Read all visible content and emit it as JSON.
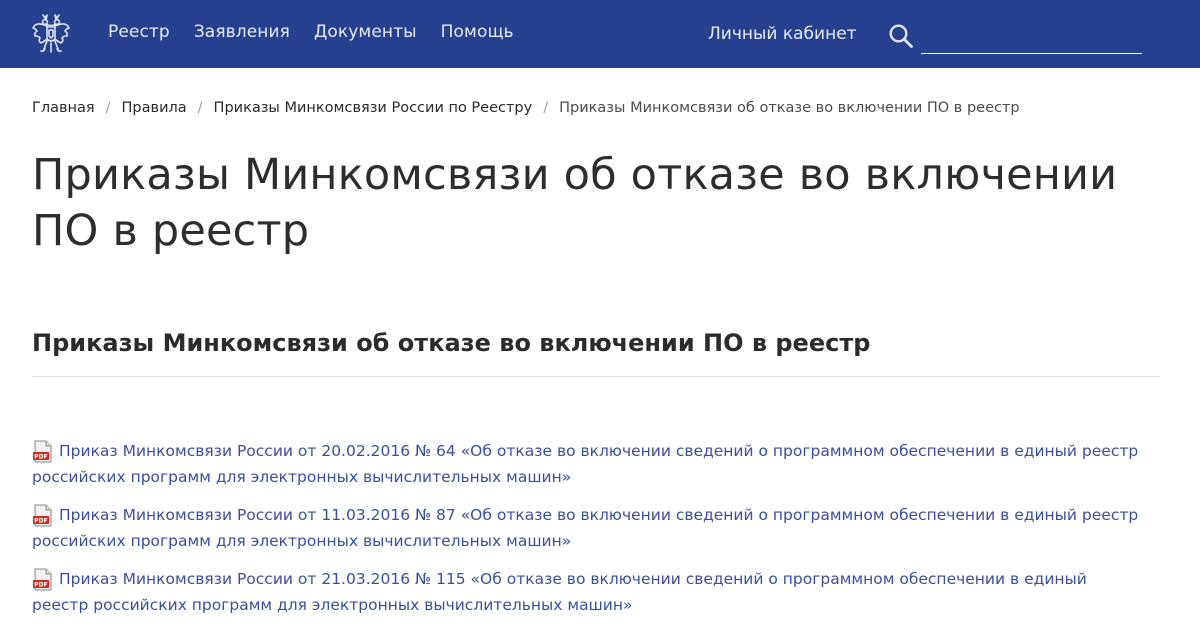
{
  "header": {
    "nav": [
      {
        "label": "Реестр"
      },
      {
        "label": "Заявления"
      },
      {
        "label": "Документы"
      },
      {
        "label": "Помощь"
      }
    ],
    "cabinet_label": "Личный кабинет",
    "search": {
      "value": "",
      "placeholder": ""
    },
    "brand_color": "#24408e",
    "emblem_icon": "double-headed-eagle-emblem",
    "search_icon": "magnifier"
  },
  "breadcrumb": [
    {
      "label": "Главная"
    },
    {
      "label": "Правила"
    },
    {
      "label": "Приказы Минкомсвязи России по Реестру"
    },
    {
      "label": "Приказы Минкомсвязи об отказе во включении ПО в реестр"
    }
  ],
  "breadcrumb_separator": "/",
  "page_title": "Приказы Минкомсвязи об отказе во включении ПО в реестр",
  "section_title": "Приказы Минкомсвязи об отказе во включении ПО в реестр",
  "documents": [
    {
      "icon": "pdf",
      "label": "Приказ Минкомсвязи России от 20.02.2016 № 64 «Об отказе во включении сведений о программном обеспечении в единый реестр российских программ для электронных вычислительных машин»"
    },
    {
      "icon": "pdf",
      "label": "Приказ Минкомсвязи России от 11.03.2016 № 87 «Об отказе во включении сведений о программном обеспечении в единый реестр российских программ для электронных вычислительных машин»"
    },
    {
      "icon": "pdf",
      "label": "Приказ Минкомсвязи России от 21.03.2016 № 115 «Об отказе во включении сведений о программном обеспечении в единый реестр российских программ для электронных вычислительных машин»"
    }
  ],
  "link_color": "#3b4f9c"
}
